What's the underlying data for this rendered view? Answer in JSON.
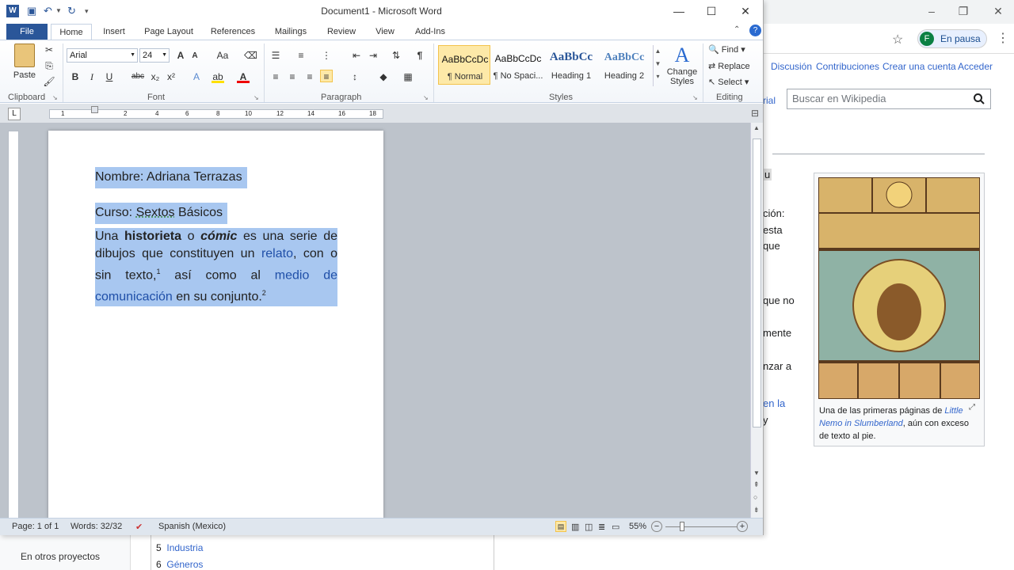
{
  "browser": {
    "profile_initial": "F",
    "profile_label": "En pausa",
    "links": [
      "Discusión",
      "Contribuciones",
      "Crear una cuenta",
      "Acceder"
    ],
    "search_placeholder": "Buscar en Wikipedia",
    "partial_left": [
      "u",
      "ción:",
      "esta",
      "que",
      "que no",
      "mente",
      "nzar a",
      "en la",
      "y"
    ],
    "rial_fragment": "rial",
    "figure_caption_pre": "Una de las primeras páginas de ",
    "figure_caption_link": "Little Nemo in Slumberland",
    "figure_caption_post": ", aún con exceso de texto al pie.",
    "bottom_left": "En otros proyectos",
    "toc": [
      {
        "num": "5",
        "label": "Industria"
      },
      {
        "num": "6",
        "label": "Géneros"
      }
    ]
  },
  "word": {
    "title": "Document1 - Microsoft Word",
    "tabs": [
      "File",
      "Home",
      "Insert",
      "Page Layout",
      "References",
      "Mailings",
      "Review",
      "View",
      "Add-Ins"
    ],
    "font_name": "Arial",
    "font_size": "24",
    "groups": [
      "Clipboard",
      "Font",
      "Paragraph",
      "Styles",
      "Editing"
    ],
    "paste_label": "Paste",
    "styles": [
      {
        "sample": "AaBbCcDc",
        "name": "¶ Normal"
      },
      {
        "sample": "AaBbCcDc",
        "name": "¶ No Spaci..."
      },
      {
        "sample": "AaBbCc",
        "name": "Heading 1"
      },
      {
        "sample": "AaBbCc",
        "name": "Heading 2"
      }
    ],
    "change_styles": "Change Styles",
    "find": "Find",
    "replace": "Replace",
    "select": "Select",
    "ruler_numbers": [
      "1",
      "2",
      "4",
      "6",
      "8",
      "10",
      "12",
      "14",
      "16",
      "18"
    ],
    "doc": {
      "name_line": "Nombre: Adriana Terrazas",
      "course_prefix": "Curso: ",
      "course_a": "Sextos",
      "course_b": " Básicos",
      "b1": "Una ",
      "b2": "historieta",
      "b3": " o ",
      "b4": "cómic",
      "b5": " es una serie de dibujos que constituyen un ",
      "b6": "relato",
      "b7": ", con o sin texto,",
      "sup1": "1",
      "b8": " así como al ",
      "b9": "medio de comunicación",
      "b10": " en su conjunto.",
      "sup2": "2"
    },
    "status": {
      "page": "Page: 1 of 1",
      "words": "Words: 32/32",
      "language": "Spanish (Mexico)",
      "zoom": "55%"
    }
  }
}
